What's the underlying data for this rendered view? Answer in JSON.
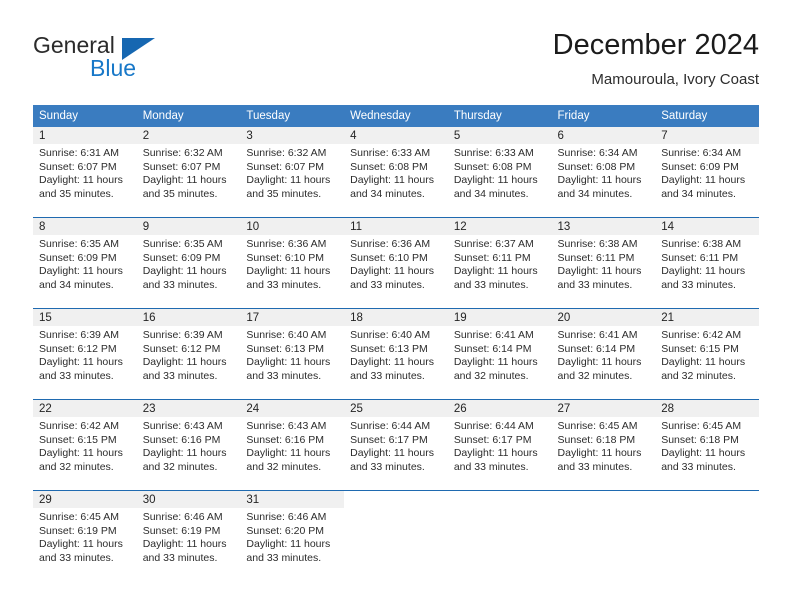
{
  "brand": {
    "name_top": "General",
    "name_bottom": "Blue",
    "triangle_color": "#1667b1",
    "blue_color": "#1878c8",
    "icon": "triangle-logo-icon"
  },
  "header": {
    "title": "December 2024",
    "subtitle": "Mamouroula, Ivory Coast"
  },
  "theme": {
    "header_bar_color": "#3a7cc0",
    "row_divider_color": "#1f6ab0",
    "daynum_band_color": "#f0f0f0",
    "text_color": "#2c2c2c"
  },
  "weekday_headers": [
    "Sunday",
    "Monday",
    "Tuesday",
    "Wednesday",
    "Thursday",
    "Friday",
    "Saturday"
  ],
  "weeks": [
    [
      {
        "day": "1",
        "sunrise": "Sunrise: 6:31 AM",
        "sunset": "Sunset: 6:07 PM",
        "daylight_line1": "Daylight: 11 hours",
        "daylight_line2": "and 35 minutes."
      },
      {
        "day": "2",
        "sunrise": "Sunrise: 6:32 AM",
        "sunset": "Sunset: 6:07 PM",
        "daylight_line1": "Daylight: 11 hours",
        "daylight_line2": "and 35 minutes."
      },
      {
        "day": "3",
        "sunrise": "Sunrise: 6:32 AM",
        "sunset": "Sunset: 6:07 PM",
        "daylight_line1": "Daylight: 11 hours",
        "daylight_line2": "and 35 minutes."
      },
      {
        "day": "4",
        "sunrise": "Sunrise: 6:33 AM",
        "sunset": "Sunset: 6:08 PM",
        "daylight_line1": "Daylight: 11 hours",
        "daylight_line2": "and 34 minutes."
      },
      {
        "day": "5",
        "sunrise": "Sunrise: 6:33 AM",
        "sunset": "Sunset: 6:08 PM",
        "daylight_line1": "Daylight: 11 hours",
        "daylight_line2": "and 34 minutes."
      },
      {
        "day": "6",
        "sunrise": "Sunrise: 6:34 AM",
        "sunset": "Sunset: 6:08 PM",
        "daylight_line1": "Daylight: 11 hours",
        "daylight_line2": "and 34 minutes."
      },
      {
        "day": "7",
        "sunrise": "Sunrise: 6:34 AM",
        "sunset": "Sunset: 6:09 PM",
        "daylight_line1": "Daylight: 11 hours",
        "daylight_line2": "and 34 minutes."
      }
    ],
    [
      {
        "day": "8",
        "sunrise": "Sunrise: 6:35 AM",
        "sunset": "Sunset: 6:09 PM",
        "daylight_line1": "Daylight: 11 hours",
        "daylight_line2": "and 34 minutes."
      },
      {
        "day": "9",
        "sunrise": "Sunrise: 6:35 AM",
        "sunset": "Sunset: 6:09 PM",
        "daylight_line1": "Daylight: 11 hours",
        "daylight_line2": "and 33 minutes."
      },
      {
        "day": "10",
        "sunrise": "Sunrise: 6:36 AM",
        "sunset": "Sunset: 6:10 PM",
        "daylight_line1": "Daylight: 11 hours",
        "daylight_line2": "and 33 minutes."
      },
      {
        "day": "11",
        "sunrise": "Sunrise: 6:36 AM",
        "sunset": "Sunset: 6:10 PM",
        "daylight_line1": "Daylight: 11 hours",
        "daylight_line2": "and 33 minutes."
      },
      {
        "day": "12",
        "sunrise": "Sunrise: 6:37 AM",
        "sunset": "Sunset: 6:11 PM",
        "daylight_line1": "Daylight: 11 hours",
        "daylight_line2": "and 33 minutes."
      },
      {
        "day": "13",
        "sunrise": "Sunrise: 6:38 AM",
        "sunset": "Sunset: 6:11 PM",
        "daylight_line1": "Daylight: 11 hours",
        "daylight_line2": "and 33 minutes."
      },
      {
        "day": "14",
        "sunrise": "Sunrise: 6:38 AM",
        "sunset": "Sunset: 6:11 PM",
        "daylight_line1": "Daylight: 11 hours",
        "daylight_line2": "and 33 minutes."
      }
    ],
    [
      {
        "day": "15",
        "sunrise": "Sunrise: 6:39 AM",
        "sunset": "Sunset: 6:12 PM",
        "daylight_line1": "Daylight: 11 hours",
        "daylight_line2": "and 33 minutes."
      },
      {
        "day": "16",
        "sunrise": "Sunrise: 6:39 AM",
        "sunset": "Sunset: 6:12 PM",
        "daylight_line1": "Daylight: 11 hours",
        "daylight_line2": "and 33 minutes."
      },
      {
        "day": "17",
        "sunrise": "Sunrise: 6:40 AM",
        "sunset": "Sunset: 6:13 PM",
        "daylight_line1": "Daylight: 11 hours",
        "daylight_line2": "and 33 minutes."
      },
      {
        "day": "18",
        "sunrise": "Sunrise: 6:40 AM",
        "sunset": "Sunset: 6:13 PM",
        "daylight_line1": "Daylight: 11 hours",
        "daylight_line2": "and 33 minutes."
      },
      {
        "day": "19",
        "sunrise": "Sunrise: 6:41 AM",
        "sunset": "Sunset: 6:14 PM",
        "daylight_line1": "Daylight: 11 hours",
        "daylight_line2": "and 32 minutes."
      },
      {
        "day": "20",
        "sunrise": "Sunrise: 6:41 AM",
        "sunset": "Sunset: 6:14 PM",
        "daylight_line1": "Daylight: 11 hours",
        "daylight_line2": "and 32 minutes."
      },
      {
        "day": "21",
        "sunrise": "Sunrise: 6:42 AM",
        "sunset": "Sunset: 6:15 PM",
        "daylight_line1": "Daylight: 11 hours",
        "daylight_line2": "and 32 minutes."
      }
    ],
    [
      {
        "day": "22",
        "sunrise": "Sunrise: 6:42 AM",
        "sunset": "Sunset: 6:15 PM",
        "daylight_line1": "Daylight: 11 hours",
        "daylight_line2": "and 32 minutes."
      },
      {
        "day": "23",
        "sunrise": "Sunrise: 6:43 AM",
        "sunset": "Sunset: 6:16 PM",
        "daylight_line1": "Daylight: 11 hours",
        "daylight_line2": "and 32 minutes."
      },
      {
        "day": "24",
        "sunrise": "Sunrise: 6:43 AM",
        "sunset": "Sunset: 6:16 PM",
        "daylight_line1": "Daylight: 11 hours",
        "daylight_line2": "and 32 minutes."
      },
      {
        "day": "25",
        "sunrise": "Sunrise: 6:44 AM",
        "sunset": "Sunset: 6:17 PM",
        "daylight_line1": "Daylight: 11 hours",
        "daylight_line2": "and 33 minutes."
      },
      {
        "day": "26",
        "sunrise": "Sunrise: 6:44 AM",
        "sunset": "Sunset: 6:17 PM",
        "daylight_line1": "Daylight: 11 hours",
        "daylight_line2": "and 33 minutes."
      },
      {
        "day": "27",
        "sunrise": "Sunrise: 6:45 AM",
        "sunset": "Sunset: 6:18 PM",
        "daylight_line1": "Daylight: 11 hours",
        "daylight_line2": "and 33 minutes."
      },
      {
        "day": "28",
        "sunrise": "Sunrise: 6:45 AM",
        "sunset": "Sunset: 6:18 PM",
        "daylight_line1": "Daylight: 11 hours",
        "daylight_line2": "and 33 minutes."
      }
    ],
    [
      {
        "day": "29",
        "sunrise": "Sunrise: 6:45 AM",
        "sunset": "Sunset: 6:19 PM",
        "daylight_line1": "Daylight: 11 hours",
        "daylight_line2": "and 33 minutes."
      },
      {
        "day": "30",
        "sunrise": "Sunrise: 6:46 AM",
        "sunset": "Sunset: 6:19 PM",
        "daylight_line1": "Daylight: 11 hours",
        "daylight_line2": "and 33 minutes."
      },
      {
        "day": "31",
        "sunrise": "Sunrise: 6:46 AM",
        "sunset": "Sunset: 6:20 PM",
        "daylight_line1": "Daylight: 11 hours",
        "daylight_line2": "and 33 minutes."
      },
      {
        "day": "",
        "sunrise": "",
        "sunset": "",
        "daylight_line1": "",
        "daylight_line2": ""
      },
      {
        "day": "",
        "sunrise": "",
        "sunset": "",
        "daylight_line1": "",
        "daylight_line2": ""
      },
      {
        "day": "",
        "sunrise": "",
        "sunset": "",
        "daylight_line1": "",
        "daylight_line2": ""
      },
      {
        "day": "",
        "sunrise": "",
        "sunset": "",
        "daylight_line1": "",
        "daylight_line2": ""
      }
    ]
  ]
}
